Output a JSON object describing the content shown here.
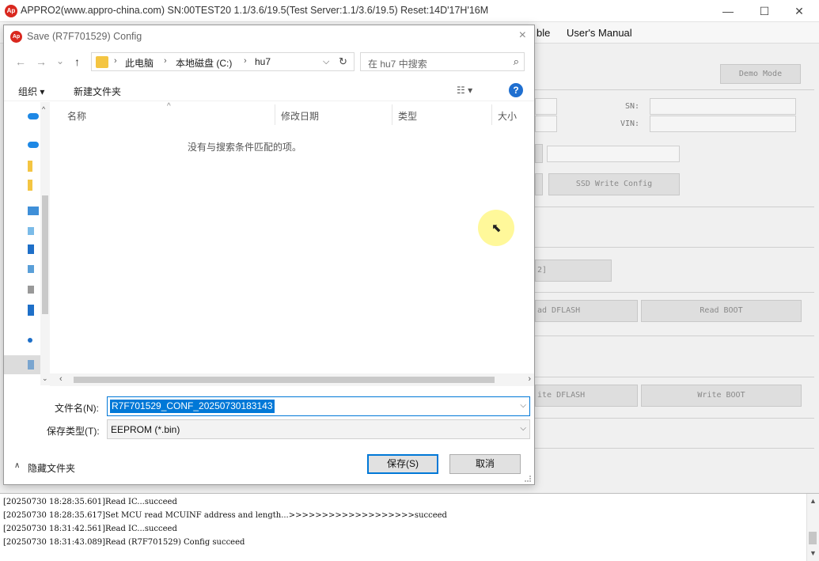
{
  "app": {
    "title": "APPRO2(www.appro-china.com)  SN:00TEST20  1.1/3.6/19.5(Test Server:1.1/3.6/19.5)  Reset:14D'17H'16M",
    "logo_text": "Ap",
    "window_controls": {
      "minimize": "—",
      "maximize": "☐",
      "close": "✕"
    },
    "menu": {
      "partial_item": "ble",
      "manual": "User's Manual"
    },
    "panel": {
      "demo_mode": "Demo Mode",
      "sn_label": "SN:",
      "vin_label": "VIN:",
      "ssd_write_config": "SSD Write Config",
      "partial_2": "2]",
      "read_dflash": "ad DFLASH",
      "read_boot": "Read BOOT",
      "write_dflash": "ite DFLASH",
      "write_boot": "Write BOOT"
    },
    "log": [
      "[20250730 18:28:35.601]Read IC...succeed",
      "[20250730 18:28:35.617]Set MCU read MCUINF address and length...>>>>>>>>>>>>>>>>>>>succeed",
      "[20250730 18:31:42.561]Read IC...succeed",
      "[20250730 18:31:43.089]Read (R7F701529) Config succeed"
    ]
  },
  "dialog": {
    "title": "Save (R7F701529) Config",
    "close": "×",
    "nav": {
      "back": "←",
      "forward": "→",
      "recent": "⌄",
      "up": "↑"
    },
    "breadcrumbs": [
      "此电脑",
      "本地磁盘 (C:)",
      "hu7"
    ],
    "search_placeholder": "在 hu7 中搜索",
    "toolbar": {
      "organize": "组织 ▾",
      "new_folder": "新建文件夹",
      "view": "☷ ▾",
      "help": "?"
    },
    "columns": [
      "名称",
      "修改日期",
      "类型",
      "大小"
    ],
    "empty_message": "没有与搜索条件匹配的项。",
    "filename_label": "文件名(N):",
    "filename_value": "R7F701529_CONF_20250730183143",
    "filetype_label": "保存类型(T):",
    "filetype_value": "EEPROM (*.bin)",
    "hide_folders": "隐藏文件夹",
    "save_button": "保存(S)",
    "cancel_button": "取消"
  }
}
